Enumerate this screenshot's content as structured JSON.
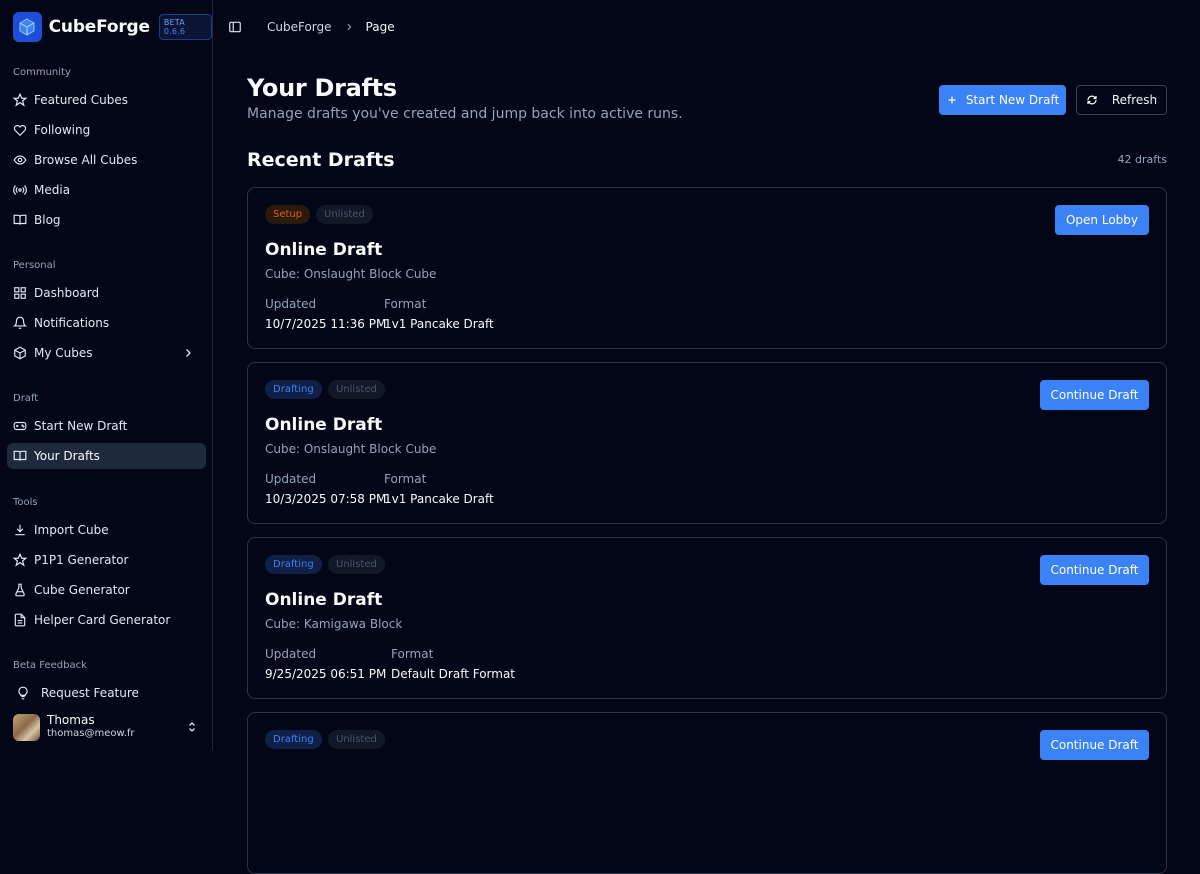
{
  "sidebar": {
    "brand": {
      "name": "CubeForge",
      "beta_label": "BETA",
      "version": "0.6.6"
    },
    "groups": [
      {
        "label": "Community",
        "items": [
          {
            "label": "Featured Cubes",
            "icon": "star-icon"
          },
          {
            "label": "Following",
            "icon": "heart-icon"
          },
          {
            "label": "Browse All Cubes",
            "icon": "eye-icon"
          },
          {
            "label": "Media",
            "icon": "broadcast-icon"
          },
          {
            "label": "Blog",
            "icon": "book-open-icon"
          }
        ]
      },
      {
        "label": "Personal",
        "items": [
          {
            "label": "Dashboard",
            "icon": "dashboard-icon"
          },
          {
            "label": "Notifications",
            "icon": "bell-icon"
          },
          {
            "label": "My Cubes",
            "icon": "cube-icon"
          }
        ]
      },
      {
        "label": "Draft",
        "items": [
          {
            "label": "Start New Draft",
            "icon": "gamepad-icon"
          },
          {
            "label": "Your Drafts",
            "icon": "book-open-icon"
          }
        ]
      },
      {
        "label": "Tools",
        "items": [
          {
            "label": "Import Cube",
            "icon": "download-icon"
          },
          {
            "label": "P1P1 Generator",
            "icon": "star-icon"
          },
          {
            "label": "Cube Generator",
            "icon": "flask-icon"
          },
          {
            "label": "Helper Card Generator",
            "icon": "file-text-icon"
          }
        ]
      },
      {
        "label": "Beta Feedback",
        "items": [
          {
            "label": "Request Feature",
            "icon": "lightbulb-icon"
          }
        ]
      }
    ],
    "user": {
      "name": "Thomas",
      "email": "thomas@meow.fr"
    }
  },
  "breadcrumb": {
    "root": "CubeForge",
    "current": "Page"
  },
  "page": {
    "title": "Your Drafts",
    "subtitle": "Manage drafts you've created and jump back into active runs.",
    "new_draft_label": "Start New Draft",
    "refresh_label": "Refresh",
    "section_title": "Recent Drafts",
    "count": "42 drafts"
  },
  "labels": {
    "updated": "Updated",
    "format": "Format"
  },
  "drafts": [
    {
      "status": "Setup",
      "visibility": "Unlisted",
      "title": "Online Draft",
      "cube": "Cube: Onslaught Block Cube",
      "updated": "10/7/2025 11:36 PM",
      "format": "1v1 Pancake Draft",
      "action": "Open Lobby"
    },
    {
      "status": "Drafting",
      "visibility": "Unlisted",
      "title": "Online Draft",
      "cube": "Cube: Onslaught Block Cube",
      "updated": "10/3/2025 07:58 PM",
      "format": "1v1 Pancake Draft",
      "action": "Continue Draft"
    },
    {
      "status": "Drafting",
      "visibility": "Unlisted",
      "title": "Online Draft",
      "cube": "Cube: Kamigawa Block",
      "updated": "9/25/2025 06:51 PM",
      "format": "Default Draft Format",
      "action": "Continue Draft"
    },
    {
      "status": "Drafting",
      "visibility": "Unlisted",
      "action": "Continue Draft"
    }
  ],
  "colors": {
    "accent": "#3b82f6",
    "background": "#020617",
    "setup": "#ea580c"
  }
}
